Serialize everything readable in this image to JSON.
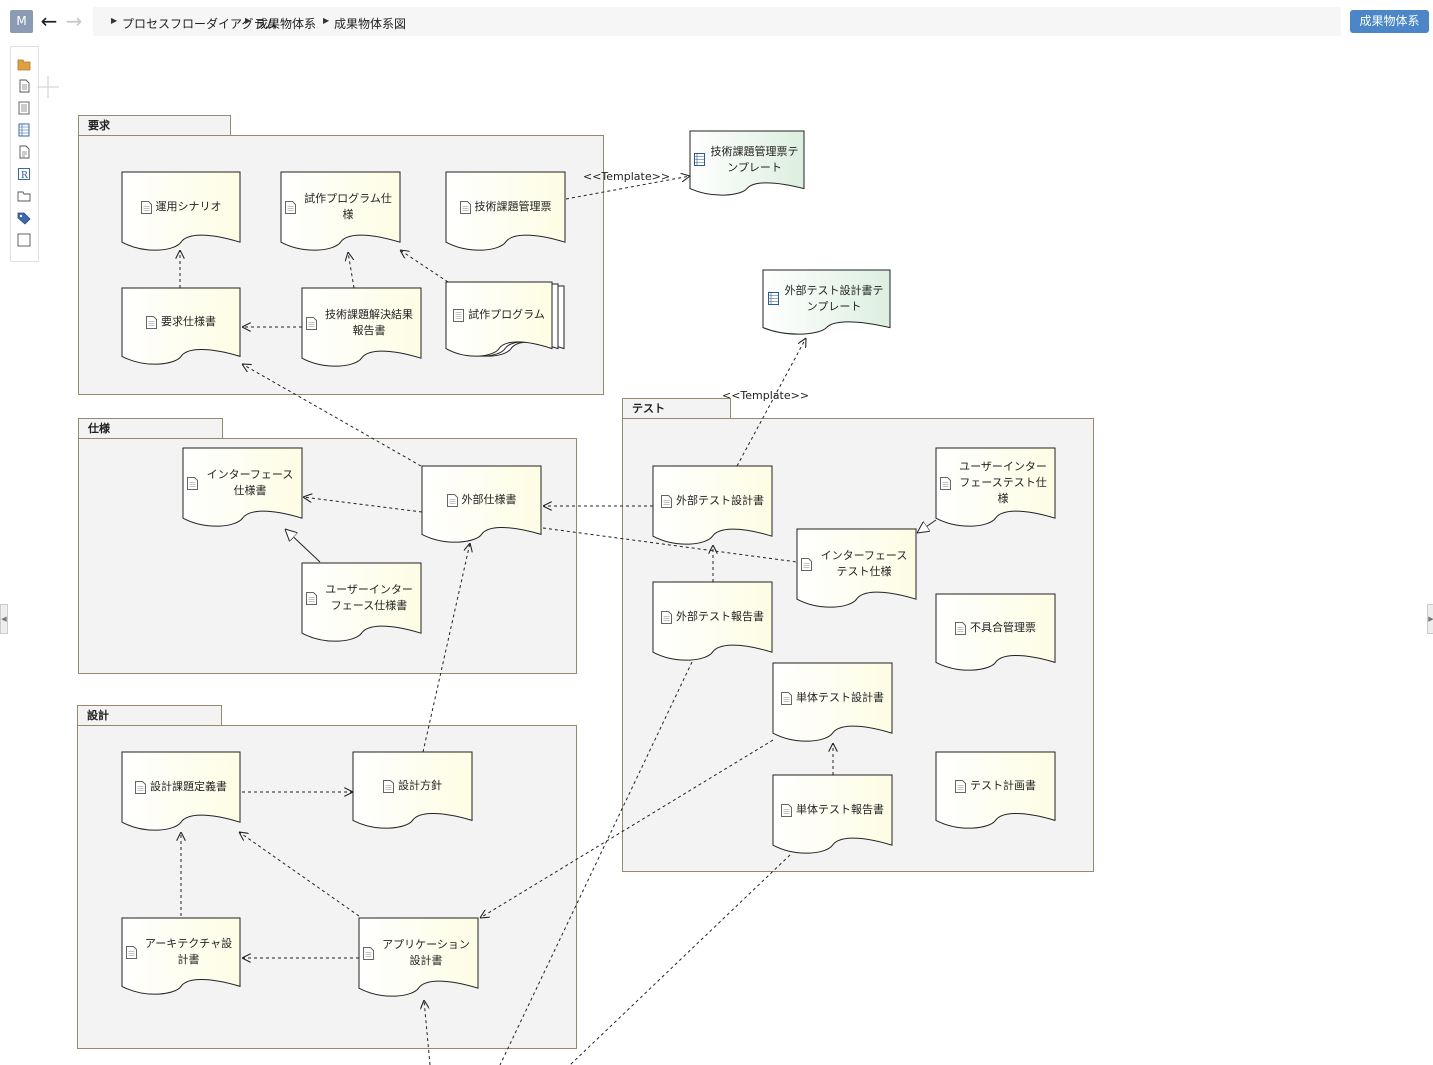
{
  "window": {
    "menu_button": "M",
    "breadcrumb": [
      "プロセスフローダイアグラム",
      "成果物体系",
      "成果物体系図"
    ],
    "primary_button": "成果物体系"
  },
  "toolbox": {
    "tools": [
      "folder-icon",
      "document-icon",
      "list-icon",
      "table-icon",
      "page-icon",
      "requirement-icon",
      "boundary-icon",
      "tag-icon",
      "rectangle-icon"
    ]
  },
  "colors": {
    "artifact_fill": "#fdfde4",
    "template_fill": "#dcefe0",
    "package_border": "#968a6c",
    "package_fill": "#f3f3f3",
    "accent": "#4a86c8"
  },
  "diagram": {
    "packages": {
      "req": "要求",
      "spec": "仕様",
      "design": "設計",
      "test": "テスト"
    },
    "artifacts": {
      "unyou": "運用シナリオ",
      "shisaku_spec": "試作プログラム仕様",
      "gijutsu_kanri": "技術課題管理票",
      "youkyu": "要求仕様書",
      "gijutsu_kaiketsu": "技術課題解決結果報告書",
      "shisaku_prog": "試作プログラム",
      "tmpl_gijutsu": "技術課題管理票テンプレート",
      "tmpl_gaibu_test": "外部テスト設計書テンプレート",
      "if_spec": "インターフェース仕様書",
      "gaibu": "外部仕様書",
      "ui_spec": "ユーザーインターフェース仕様書",
      "sekkei_kadai": "設計課題定義書",
      "sekkei_houshin": "設計方針",
      "arch": "アーキテクチャ設計書",
      "app": "アプリケーション設計書",
      "gaibu_test_design": "外部テスト設計書",
      "ui_test": "ユーザーインターフェーステスト仕様",
      "if_test": "インターフェーステスト仕様",
      "gaibu_test_report": "外部テスト報告書",
      "fuguai": "不具合管理票",
      "tantai_design": "単体テスト設計書",
      "tantai_report": "単体テスト報告書",
      "test_plan": "テスト計画書"
    },
    "stereotypes": {
      "template_1": "<<Template>>",
      "template_2": "<<Template>>"
    }
  }
}
